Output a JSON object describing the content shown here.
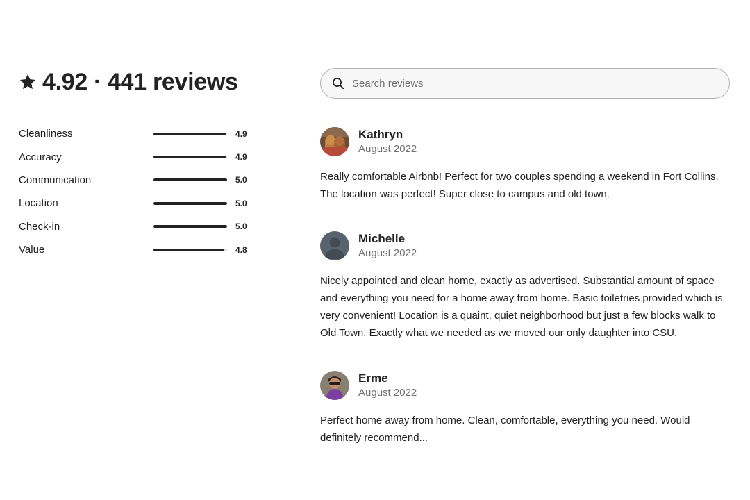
{
  "summary": {
    "star_icon": "star-icon",
    "score": "4.92",
    "separator": "·",
    "count_label": "441 reviews"
  },
  "ratings": [
    {
      "label": "Cleanliness",
      "score": "4.9",
      "fill": 0.98
    },
    {
      "label": "Accuracy",
      "score": "4.9",
      "fill": 0.98
    },
    {
      "label": "Communication",
      "score": "5.0",
      "fill": 1.0
    },
    {
      "label": "Location",
      "score": "5.0",
      "fill": 1.0
    },
    {
      "label": "Check-in",
      "score": "5.0",
      "fill": 1.0
    },
    {
      "label": "Value",
      "score": "4.8",
      "fill": 0.96
    }
  ],
  "search": {
    "icon": "search-icon",
    "placeholder": "Search reviews",
    "value": ""
  },
  "reviews": [
    {
      "name": "Kathryn",
      "date": "August 2022",
      "avatar": "photo-avatar",
      "text": "Really comfortable Airbnb! Perfect for two couples spending a weekend in Fort Collins. The location was perfect! Super close to campus and old town."
    },
    {
      "name": "Michelle",
      "date": "August 2022",
      "avatar": "default-avatar",
      "text": "Nicely appointed and clean home, exactly as advertised. Substantial amount of space and everything you need for a home away from home. Basic toiletries provided which is very convenient! Location is a quaint, quiet neighborhood but just a few blocks walk to Old Town. Exactly what we needed as we moved our only daughter into CSU."
    },
    {
      "name": "Erme",
      "date": "August 2022",
      "avatar": "photo-avatar",
      "text": "Perfect home away from home. Clean, comfortable, everything you need. Would definitely recommend..."
    }
  ],
  "colors": {
    "text": "#222222",
    "muted": "#717171",
    "bar_track": "#dddddd",
    "bar_fill": "#222222",
    "search_bg": "#f7f7f7",
    "search_border": "#b0b0b0"
  }
}
